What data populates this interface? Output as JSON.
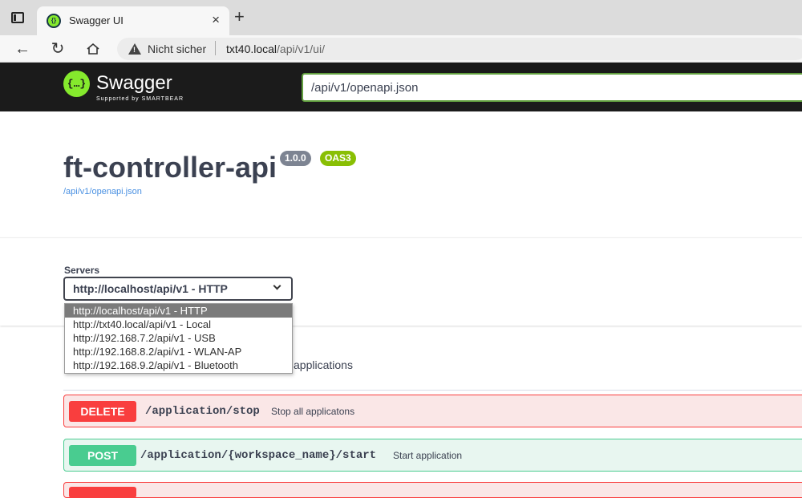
{
  "browser": {
    "tab_title": "Swagger UI",
    "close_symbol": "×",
    "new_tab_symbol": "+",
    "security_label": "Nicht sicher",
    "url_host": "txt40.local",
    "url_path": "/api/v1/ui/"
  },
  "swagger": {
    "brand": "Swagger",
    "sub_brand": "Supported by SMARTBEAR",
    "spec_url_value": "/api/v1/openapi.json",
    "accent_color": "#85ea2d"
  },
  "info": {
    "title": "ft-controller-api",
    "version": "1.0.0",
    "oas": "OAS3",
    "spec_link": "/api/v1/openapi.json"
  },
  "servers": {
    "label": "Servers",
    "selected": "http://localhost/api/v1 - HTTP",
    "options": [
      "http://localhost/api/v1 - HTTP",
      "http://txt40.local/api/v1 - Local",
      "http://192.168.7.2/api/v1 - USB",
      "http://192.168.8.2/api/v1 - WLAN-AP",
      "http://192.168.9.2/api/v1 - Bluetooth"
    ]
  },
  "tag": {
    "description_visible": "applications"
  },
  "operations": [
    {
      "method": "DELETE",
      "path": "/application/stop",
      "summary": "Stop all applicatons",
      "color": "#f93e3e"
    },
    {
      "method": "POST",
      "path": "/application/{workspace_name}/start",
      "summary": "Start application",
      "color": "#49cc90"
    }
  ]
}
